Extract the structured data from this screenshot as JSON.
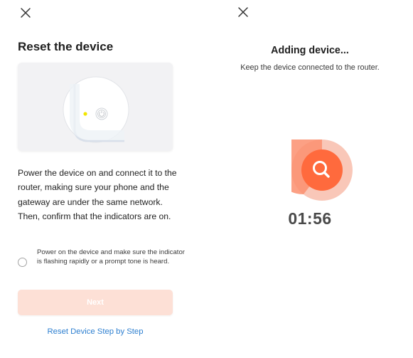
{
  "left_panel": {
    "close_icon": "close-icon",
    "title": "Reset the device",
    "illustration_icon": "device-reset-illustration",
    "indicator_color": "#f2e600",
    "instruction": "Power the device on and connect it to the router, making sure your phone and the gateway are under the same network. Then, confirm that the indicators are on.",
    "confirm_text": "Power on the device and make sure the indicator is flashing rapidly or a prompt tone is heard.",
    "confirm_checked": false,
    "next_label": "Next",
    "next_enabled": false,
    "reset_link": "Reset Device Step by Step"
  },
  "right_panel": {
    "close_icon": "close-icon",
    "title": "Adding device...",
    "subtitle": "Keep the device connected to the router.",
    "search_icon": "search-icon",
    "timer": "01:56"
  },
  "colors": {
    "accent": "#ff6a3d",
    "accent_light": "#f9c7b8",
    "next_disabled_bg": "#fde0d6",
    "link": "#2d7fd0"
  }
}
